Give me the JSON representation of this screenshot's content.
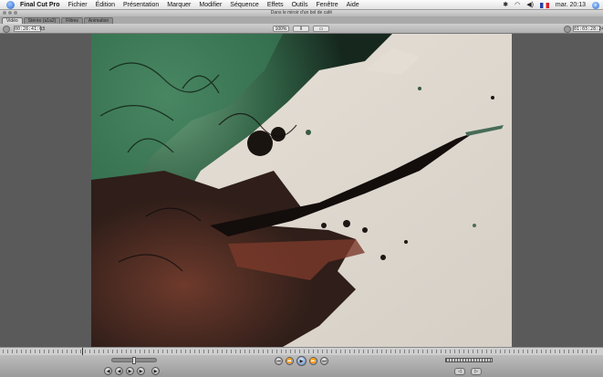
{
  "menubar": {
    "app_name": "Final Cut Pro",
    "items": [
      "Fichier",
      "Édition",
      "Présentation",
      "Marquer",
      "Modifier",
      "Séquence",
      "Effets",
      "Outils",
      "Fenêtre",
      "Aide"
    ],
    "clock": "mar. 20:13",
    "icons": [
      "apple-icon",
      "bluetooth-icon",
      "wifi-icon",
      "volume-icon",
      "flag-icon",
      "spotlight-icon"
    ]
  },
  "window": {
    "title": "Dans le miroir d'un bol de café"
  },
  "tabs": [
    {
      "label": "Vidéo",
      "active": true
    },
    {
      "label": "Stéréo (a1a2)",
      "active": false
    },
    {
      "label": "Filtres",
      "active": false
    },
    {
      "label": "Animation",
      "active": false
    }
  ],
  "controls": {
    "duration": "00:28:41:03",
    "current_tc": "01:03:28:24",
    "zoom_label": "100%",
    "view_label": "ll",
    "overlay_label": "▭"
  },
  "transport": {
    "buttons": [
      "⏮",
      "⏪",
      "▶",
      "⏩",
      "⏭"
    ],
    "left_buttons": [
      "◀",
      "◀",
      "▶",
      "▶",
      "▶"
    ],
    "mark_in": "◁",
    "mark_out": "▷"
  },
  "colors": {
    "background": "#5b5b5b",
    "menubar": "#f0f0f0",
    "accent": "#5b7fb3"
  }
}
